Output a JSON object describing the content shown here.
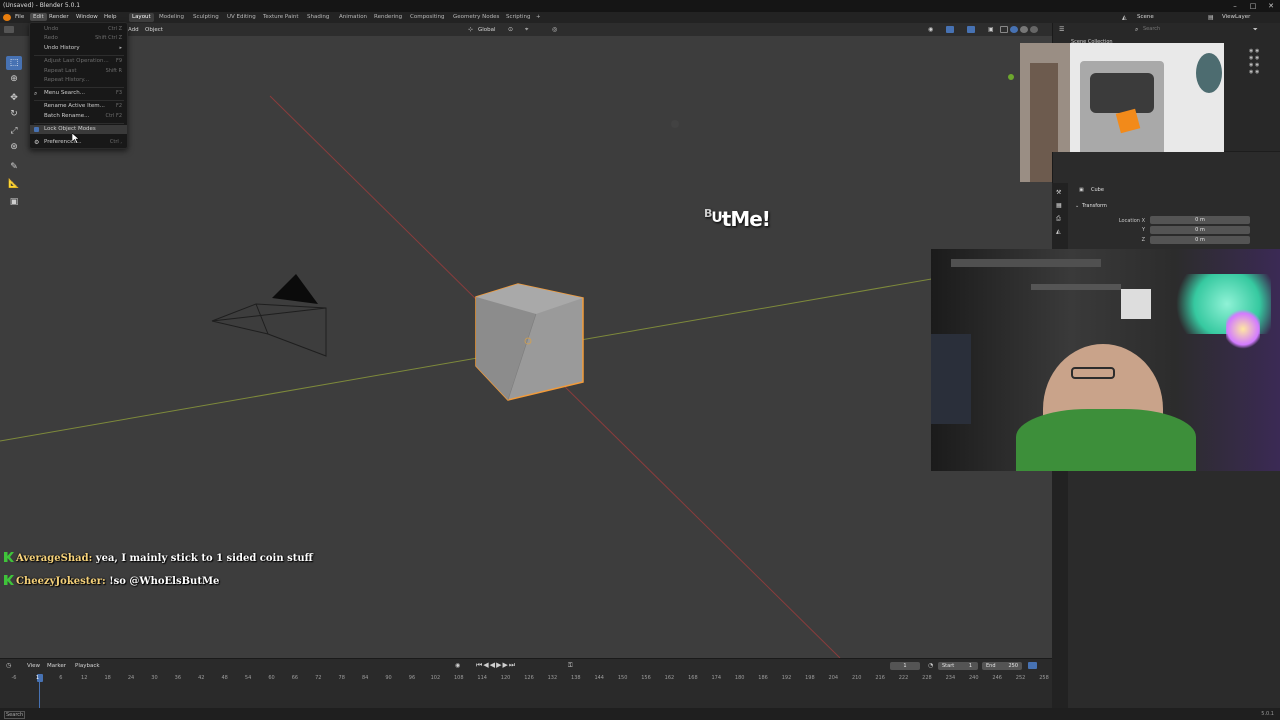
{
  "window": {
    "title": "(Unsaved) - Blender 5.0.1"
  },
  "menubar": {
    "menus": [
      "File",
      "Edit",
      "Render",
      "Window",
      "Help"
    ],
    "workspaces": [
      "Layout",
      "Modeling",
      "Sculpting",
      "UV Editing",
      "Texture Paint",
      "Shading",
      "Animation",
      "Rendering",
      "Compositing",
      "Geometry Nodes",
      "Scripting"
    ],
    "add_tab": "+",
    "scene": "Scene",
    "view_layer": "ViewLayer"
  },
  "viewport_header": {
    "add_menu": "Add",
    "object_menu": "Object",
    "orientation": "Global"
  },
  "edit_menu": {
    "undo": {
      "label": "Undo",
      "shortcut": "Ctrl Z"
    },
    "redo": {
      "label": "Redo",
      "shortcut": "Shift Ctrl Z"
    },
    "undo_history": {
      "label": "Undo History"
    },
    "adjust_last": {
      "label": "Adjust Last Operation...",
      "shortcut": "F9"
    },
    "repeat_last": {
      "label": "Repeat Last",
      "shortcut": "Shift R"
    },
    "repeat_history": {
      "label": "Repeat History..."
    },
    "menu_search": {
      "label": "Menu Search...",
      "shortcut": "F3"
    },
    "rename_active": {
      "label": "Rename Active Item...",
      "shortcut": "F2"
    },
    "batch_rename": {
      "label": "Batch Rename...",
      "shortcut": "Ctrl F2"
    },
    "lock_object_modes": {
      "label": "Lock Object Modes"
    },
    "preferences": {
      "label": "Preferences...",
      "shortcut": "Ctrl ,"
    }
  },
  "outliner": {
    "search_placeholder": "Search",
    "collection": "Scene Collection"
  },
  "properties": {
    "object_name": "Cube",
    "panel_title": "Transform",
    "location_label": "Location X",
    "y_label": "Y",
    "z_label": "Z",
    "x_value": "0 m",
    "y_value": "0 m",
    "z_value": "0 m"
  },
  "overlay_text": {
    "small_b": "B",
    "small_u": "U",
    "main": "tMe!"
  },
  "chat": [
    {
      "user": "AverageShad:",
      "message": "yea, I mainly stick to 1 sided coin stuff"
    },
    {
      "user": "CheezyJokester:",
      "message": "!so @WhoElsButMe"
    }
  ],
  "timeline": {
    "menus": [
      "View",
      "Marker",
      "Playback"
    ],
    "current_frame": "1",
    "start_label": "Start",
    "start_value": "1",
    "end_label": "End",
    "end_value": "250",
    "frame_ticks": [
      "-6",
      "1",
      "6",
      "12",
      "18",
      "24",
      "30",
      "36",
      "42",
      "48",
      "54",
      "60",
      "66",
      "72",
      "78",
      "84",
      "90",
      "96",
      "102",
      "108",
      "114",
      "120",
      "126",
      "132",
      "138",
      "144",
      "150",
      "156",
      "162",
      "168",
      "174",
      "180",
      "186",
      "192",
      "198",
      "204",
      "210",
      "216",
      "222",
      "228",
      "234",
      "240",
      "246",
      "252",
      "258"
    ]
  },
  "statusbar": {
    "search": "Search",
    "version": "5.0.1"
  },
  "colors": {
    "accent": "#4772b3",
    "selection_outline": "#f29b3a",
    "chat_user": "#f6d27a",
    "chat_badge": "#3fc43a"
  }
}
